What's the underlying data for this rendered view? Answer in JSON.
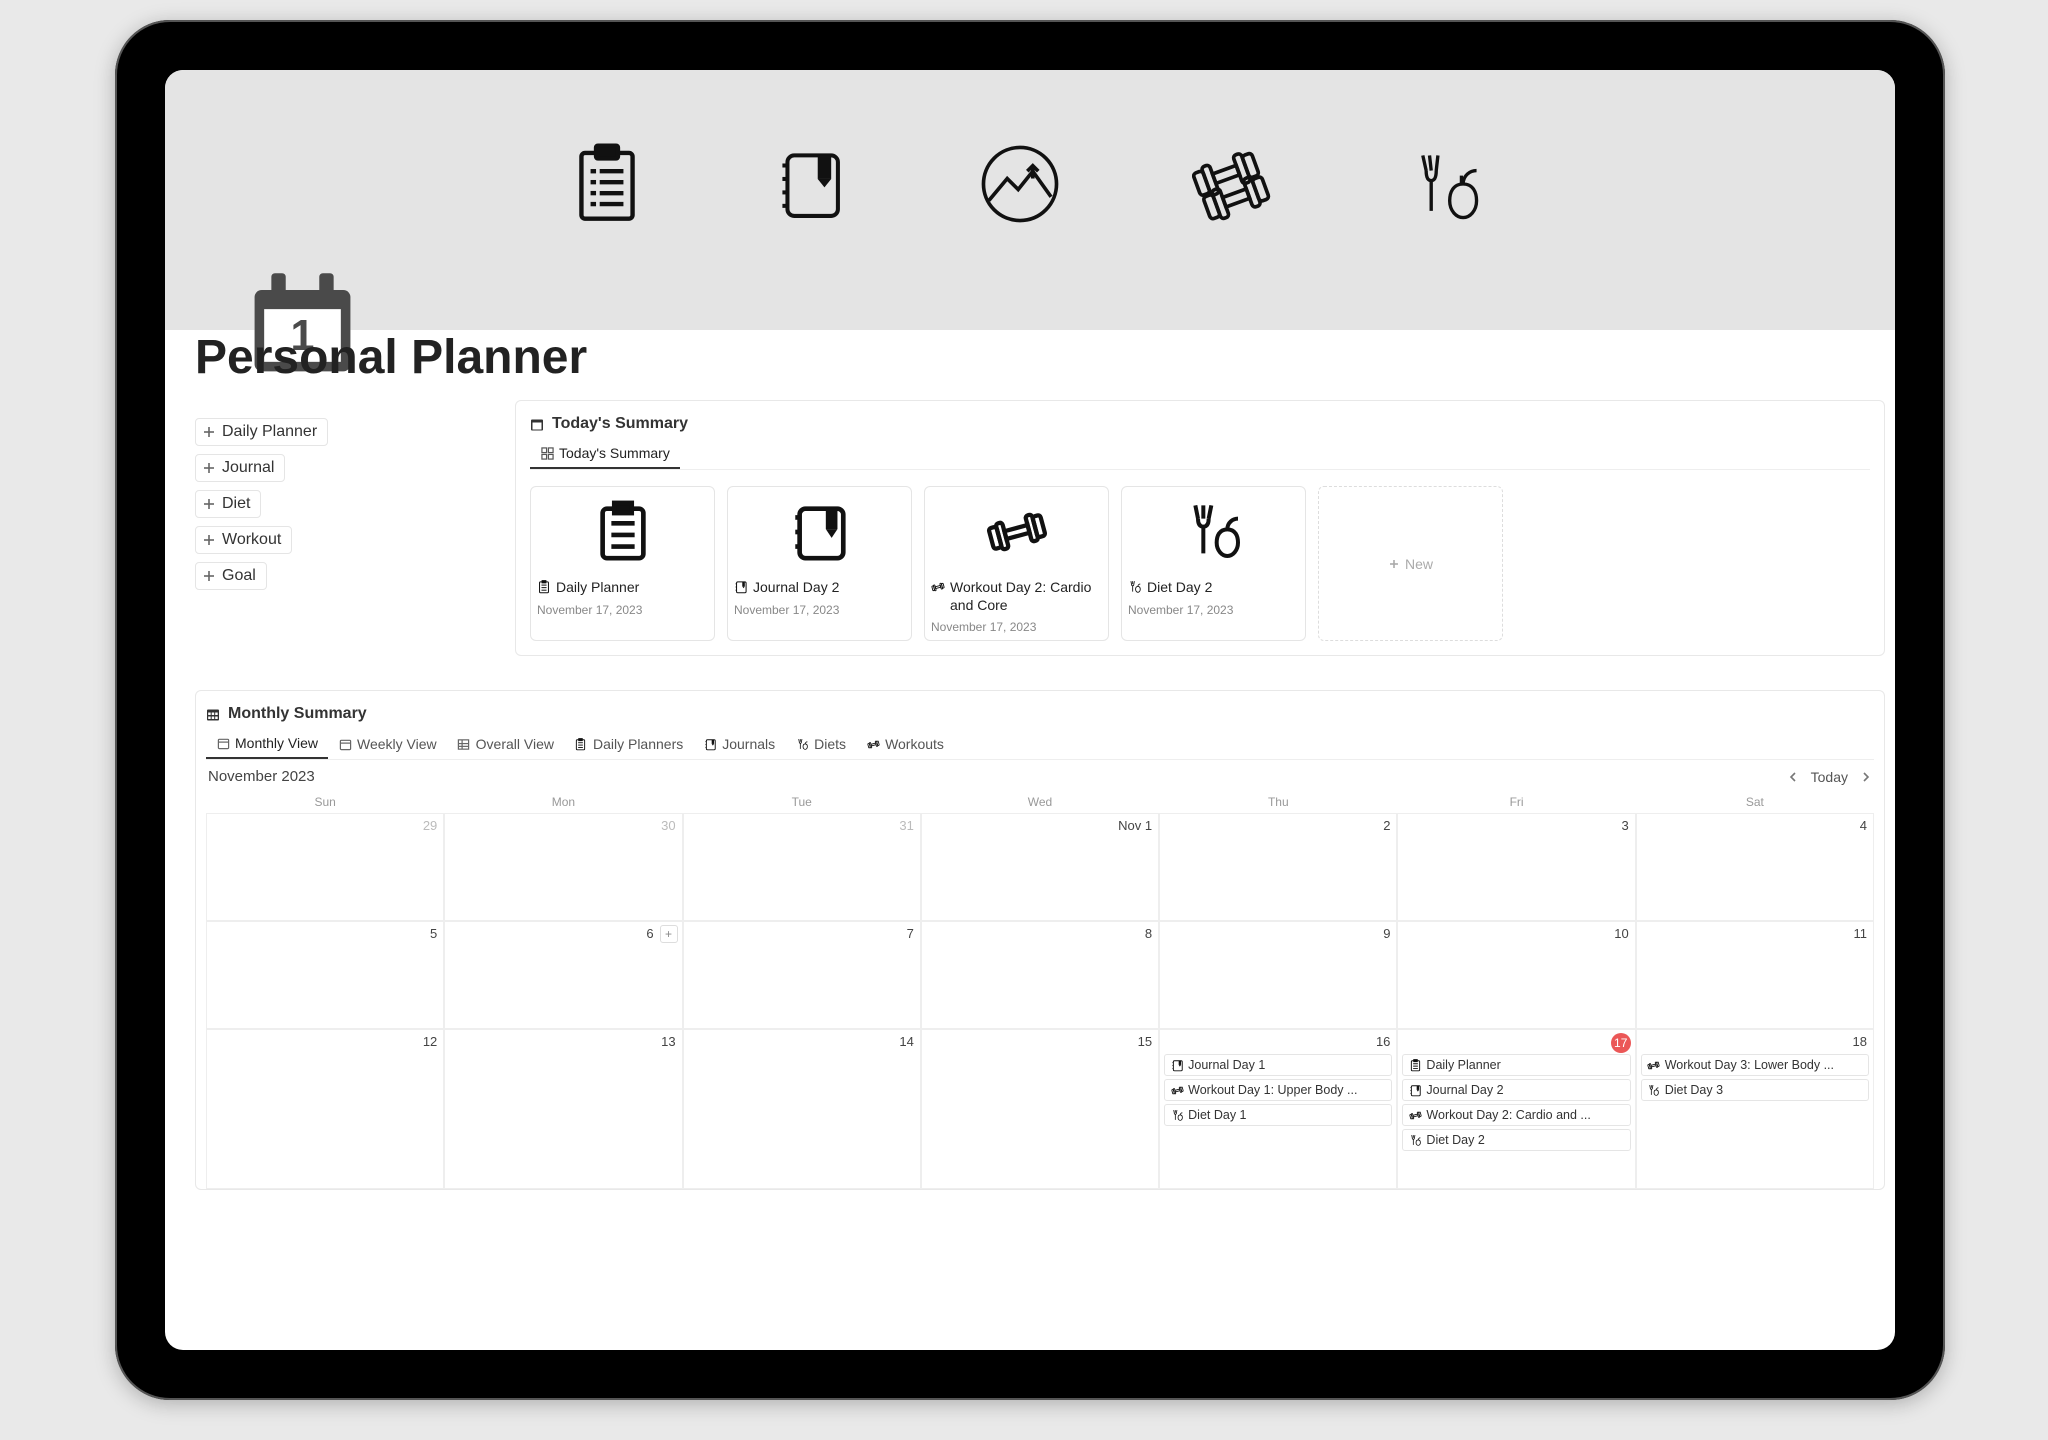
{
  "page": {
    "title": "Personal Planner"
  },
  "top_nav": {
    "items": [
      {
        "name": "clipboard-icon"
      },
      {
        "name": "journal-icon"
      },
      {
        "name": "mountain-icon"
      },
      {
        "name": "dumbbell-icon"
      },
      {
        "name": "diet-icon"
      }
    ]
  },
  "quicklinks": [
    {
      "label": "Daily Planner"
    },
    {
      "label": "Journal"
    },
    {
      "label": "Diet"
    },
    {
      "label": "Workout"
    },
    {
      "label": "Goal"
    }
  ],
  "today_summary": {
    "title": "Today's Summary",
    "tab_label": "Today's Summary",
    "cards": [
      {
        "title": "Daily Planner",
        "date": "November 17, 2023",
        "icon": "clipboard"
      },
      {
        "title": "Journal Day 2",
        "date": "November 17, 2023",
        "icon": "journal"
      },
      {
        "title": "Workout Day 2: Cardio and Core",
        "date": "November 17, 2023",
        "icon": "dumbbell"
      },
      {
        "title": "Diet Day 2",
        "date": "November 17, 2023",
        "icon": "diet"
      }
    ],
    "new_label": "New"
  },
  "monthly": {
    "title": "Monthly Summary",
    "tabs": [
      {
        "label": "Monthly View",
        "active": true
      },
      {
        "label": "Weekly View"
      },
      {
        "label": "Overall View"
      },
      {
        "label": "Daily Planners"
      },
      {
        "label": "Journals"
      },
      {
        "label": "Diets"
      },
      {
        "label": "Workouts"
      }
    ],
    "month_label": "November 2023",
    "today_label": "Today",
    "weekdays": [
      "Sun",
      "Mon",
      "Tue",
      "Wed",
      "Thu",
      "Fri",
      "Sat"
    ],
    "rows": [
      [
        {
          "num": "29",
          "muted": true
        },
        {
          "num": "30",
          "muted": true
        },
        {
          "num": "31",
          "muted": true
        },
        {
          "num": "Nov 1",
          "first": true
        },
        {
          "num": "2"
        },
        {
          "num": "3"
        },
        {
          "num": "4"
        }
      ],
      [
        {
          "num": "5"
        },
        {
          "num": "6",
          "hover": true
        },
        {
          "num": "7"
        },
        {
          "num": "8"
        },
        {
          "num": "9"
        },
        {
          "num": "10"
        },
        {
          "num": "11"
        }
      ],
      [
        {
          "num": "12"
        },
        {
          "num": "13"
        },
        {
          "num": "14"
        },
        {
          "num": "15"
        },
        {
          "num": "16",
          "events": [
            {
              "label": "Journal Day 1",
              "icon": "journal"
            },
            {
              "label": "Workout Day 1: Upper Body ...",
              "icon": "dumbbell"
            },
            {
              "label": "Diet Day 1",
              "icon": "diet"
            }
          ]
        },
        {
          "num": "17",
          "today": true,
          "events": [
            {
              "label": "Daily Planner",
              "icon": "clipboard"
            },
            {
              "label": "Journal Day 2",
              "icon": "journal"
            },
            {
              "label": "Workout Day 2: Cardio and ...",
              "icon": "dumbbell"
            },
            {
              "label": "Diet Day 2",
              "icon": "diet"
            }
          ]
        },
        {
          "num": "18",
          "events": [
            {
              "label": "Workout Day 3: Lower Body ...",
              "icon": "dumbbell"
            },
            {
              "label": "Diet Day 3",
              "icon": "diet"
            }
          ]
        }
      ]
    ]
  }
}
